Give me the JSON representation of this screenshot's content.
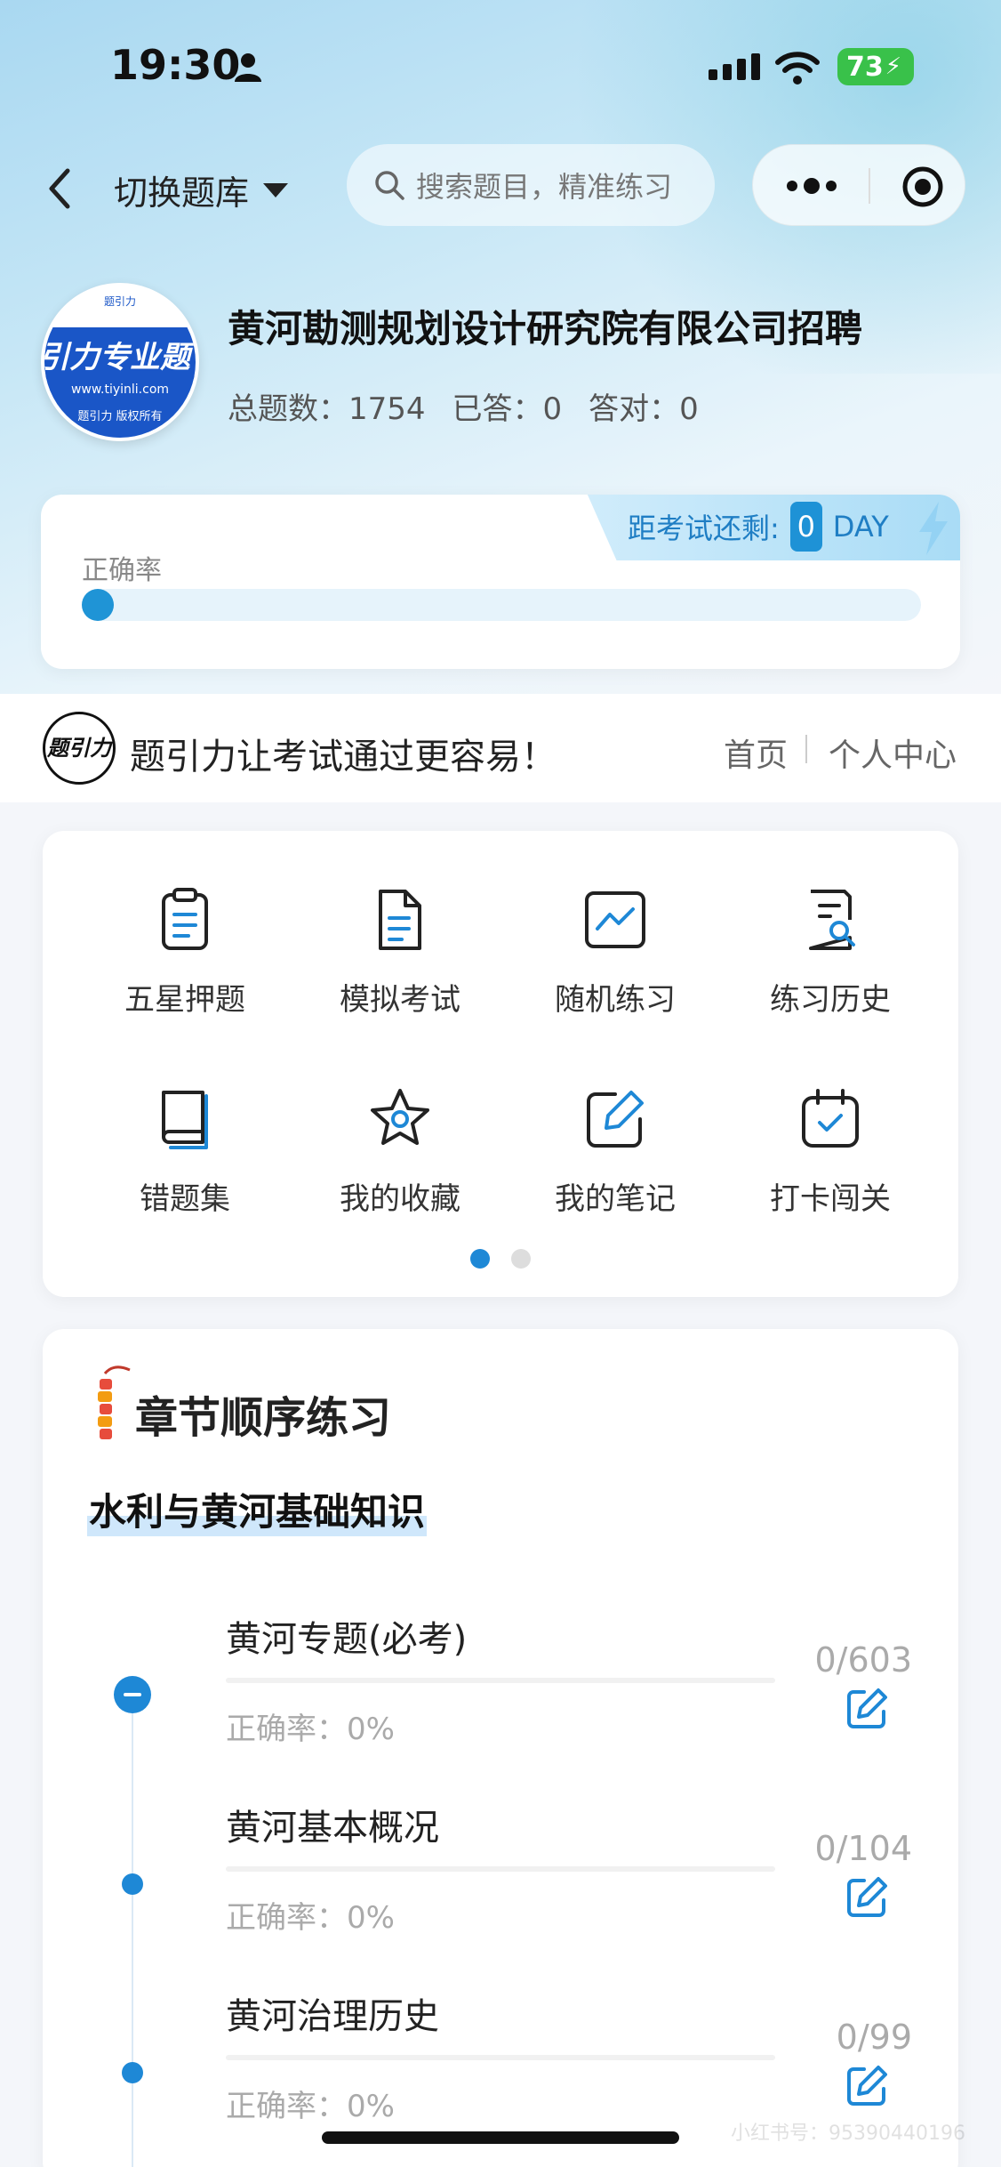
{
  "status_bar": {
    "time": "19:30",
    "battery": "73"
  },
  "nav": {
    "switch_label": "切换题库",
    "search_placeholder": "搜索题目，精准练习"
  },
  "profile": {
    "logo_top": "题引力",
    "logo_brand": "引力专业题",
    "logo_url": "www.tiyinli.com",
    "logo_copyright": "题引力 版权所有",
    "company": "黄河勘测规划设计研究院有限公司招聘",
    "total_label": "总题数：1754",
    "answered_label": "已答：0",
    "correct_label": "答对：0"
  },
  "accuracy_card": {
    "countdown_label": "距考试还剩:",
    "countdown_value": "0",
    "countdown_unit": "DAY",
    "accuracy_label": "正确率",
    "accuracy_fraction": 0
  },
  "slogan_bar": {
    "logo_text": "题引力",
    "slogan": "题引力让考试通过更容易！",
    "home": "首页",
    "personal_center": "个人中心"
  },
  "grid": {
    "items": [
      {
        "label": "五星押题",
        "icon": "clipboard-icon"
      },
      {
        "label": "模拟考试",
        "icon": "document-icon"
      },
      {
        "label": "随机练习",
        "icon": "chart-line-icon"
      },
      {
        "label": "练习历史",
        "icon": "history-search-icon"
      },
      {
        "label": "错题集",
        "icon": "book-icon"
      },
      {
        "label": "我的收藏",
        "icon": "star-icon"
      },
      {
        "label": "我的笔记",
        "icon": "note-edit-icon"
      },
      {
        "label": "打卡闯关",
        "icon": "calendar-check-icon"
      }
    ],
    "page_indicator": {
      "pages": 2,
      "active": 1
    }
  },
  "chapters": {
    "title": "章节顺序练习",
    "section": "水利与黄河基础知识",
    "rows": [
      {
        "name": "黄河专题(必考)",
        "accuracy": "正确率：0%",
        "count": "0/603"
      },
      {
        "name": "黄河基本概况",
        "accuracy": "正确率：0%",
        "count": "0/104"
      },
      {
        "name": "黄河治理历史",
        "accuracy": "正确率：0%",
        "count": "0/99"
      }
    ]
  },
  "watermark": "小红书号：95390440196",
  "colors": {
    "accent": "#1e88d6",
    "battery": "#39c14a"
  }
}
